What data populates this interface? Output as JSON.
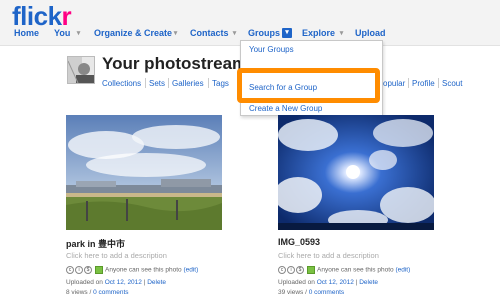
{
  "logo": {
    "part1": "flick",
    "part2": "r"
  },
  "nav": {
    "home": "Home",
    "you": "You",
    "organize": "Organize & Create",
    "contacts": "Contacts",
    "groups": "Groups",
    "explore": "Explore",
    "upload": "Upload"
  },
  "dropdown": {
    "items": [
      "Your Groups",
      "Search for a Group",
      "Create a New Group"
    ]
  },
  "photostream": {
    "title": "Your photostream",
    "subnav": [
      "Collections",
      "Sets",
      "Galleries",
      "Tags",
      "opular",
      "Profile",
      "Scout"
    ]
  },
  "photos": [
    {
      "title": "park in 豊中市",
      "description": "Click here to add a description",
      "privacy": "Anyone can see this photo",
      "edit": "(edit)",
      "uploaded_prefix": "Uploaded on",
      "date": "Oct 12, 2012",
      "delete": "Delete",
      "views": "8 views",
      "comments": "0 comments"
    },
    {
      "title": "IMG_0593",
      "description": "Click here to add a description",
      "privacy": "Anyone can see this photo",
      "edit": "(edit)",
      "uploaded_prefix": "Uploaded on",
      "date": "Oct 12, 2012",
      "delete": "Delete",
      "views": "39 views",
      "comments": "0 comments"
    }
  ],
  "colors": {
    "link": "#1e64c8",
    "brand_pink": "#ff0084",
    "highlight": "#ff8c00"
  }
}
